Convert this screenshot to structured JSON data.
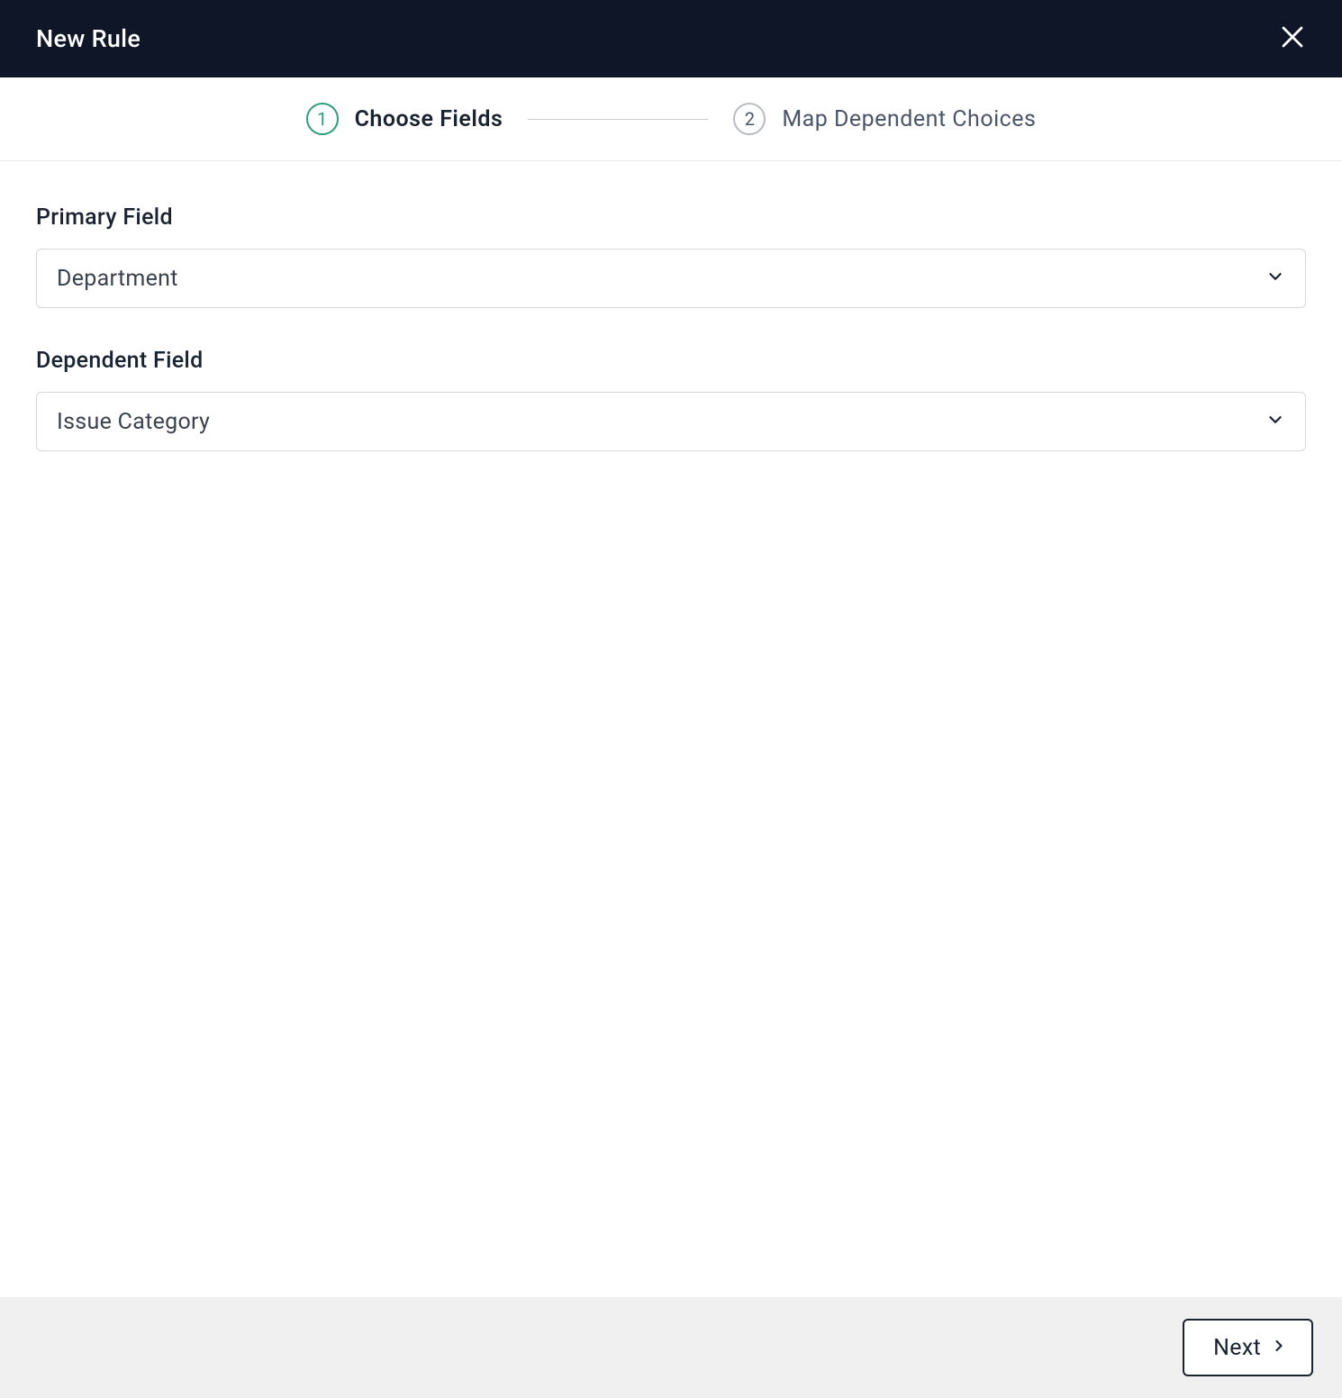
{
  "header": {
    "title": "New Rule"
  },
  "stepper": {
    "steps": [
      {
        "number": "1",
        "label": "Choose Fields",
        "active": true
      },
      {
        "number": "2",
        "label": "Map Dependent Choices",
        "active": false
      }
    ]
  },
  "content": {
    "primary_field": {
      "label": "Primary Field",
      "value": "Department"
    },
    "dependent_field": {
      "label": "Dependent Field",
      "value": "Issue Category"
    }
  },
  "footer": {
    "next_label": "Next"
  }
}
